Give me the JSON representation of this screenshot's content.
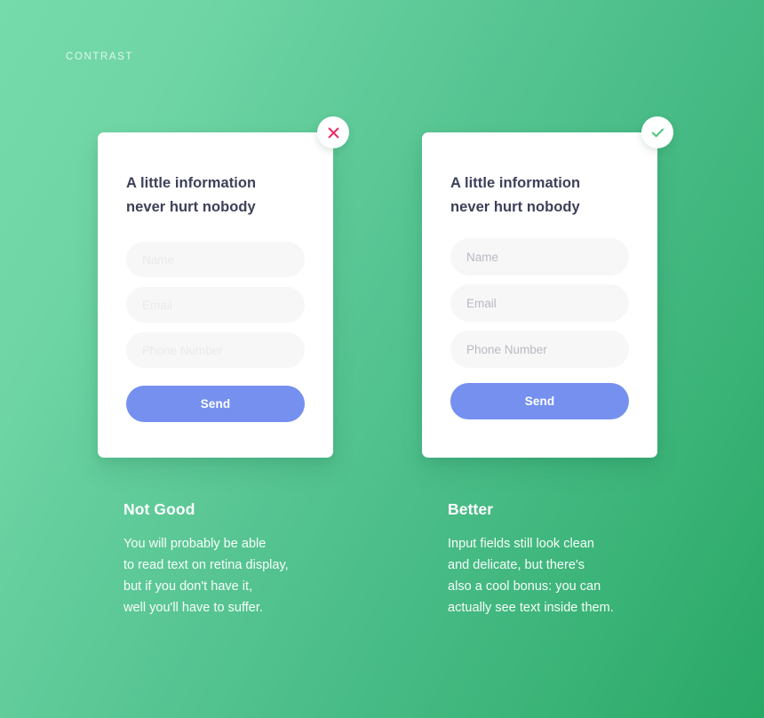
{
  "page": {
    "eyebrow": "CONTRAST",
    "background_from": "#76DBAA",
    "background_to": "#29A866"
  },
  "colors": {
    "heading": "#3D4159",
    "button": "#7590EF",
    "button_label": "#FFFFFF",
    "badge_error": "#EE2D64",
    "badge_success": "#52C77E",
    "input_bg": "#F7F7F8",
    "placeholder_low_contrast": "#EAEAEC",
    "placeholder_good_contrast": "#B9BAC2"
  },
  "cards": [
    {
      "id": "bad",
      "badge_icon": "close-icon",
      "badge_color": "#EE2D64",
      "title": "A little information\nnever hurt nobody",
      "fields": [
        {
          "name": "name",
          "placeholder": "Name",
          "value": ""
        },
        {
          "name": "email",
          "placeholder": "Email",
          "value": ""
        },
        {
          "name": "phone",
          "placeholder": "Phone Number",
          "value": ""
        }
      ],
      "submit_label": "Send",
      "caption_title": "Not Good",
      "caption_body": "You will probably be able\nto read text on retina display,\nbut if you don't have it,\nwell you'll have to suffer."
    },
    {
      "id": "good",
      "badge_icon": "check-icon",
      "badge_color": "#52C77E",
      "title": "A little information\nnever hurt nobody",
      "fields": [
        {
          "name": "name",
          "placeholder": "Name",
          "value": ""
        },
        {
          "name": "email",
          "placeholder": "Email",
          "value": ""
        },
        {
          "name": "phone",
          "placeholder": "Phone Number",
          "value": ""
        }
      ],
      "submit_label": "Send",
      "caption_title": "Better",
      "caption_body": "Input fields still look clean\nand delicate, but there's\nalso a cool bonus: you can\nactually see text inside them."
    }
  ]
}
